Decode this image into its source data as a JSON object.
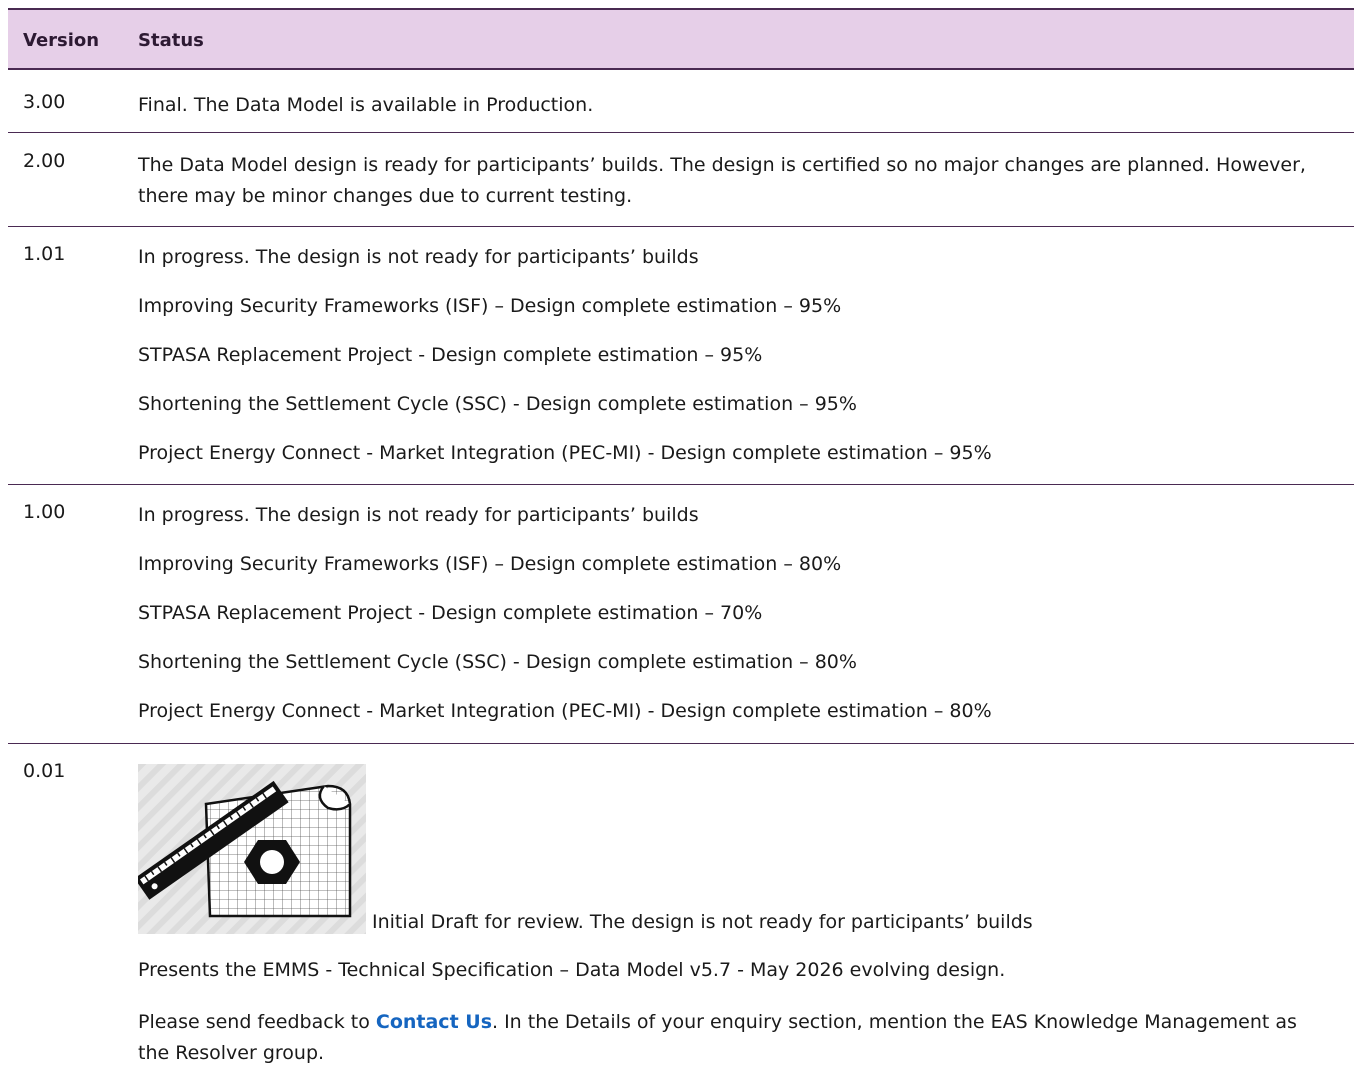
{
  "header": {
    "version": "Version",
    "status": "Status"
  },
  "rows": [
    {
      "version": "3.00",
      "lines": [
        "Final. The Data Model is available in Production."
      ]
    },
    {
      "version": "2.00",
      "lines": [
        "The Data Model design is ready for participants’ builds. The design is certified so no major changes are planned. However, there may be minor changes due to current testing."
      ]
    },
    {
      "version": "1.01",
      "lines": [
        "In progress. The design is not ready for participants’ builds",
        "Improving Security Frameworks (ISF) – Design complete estimation – 95%",
        "STPASA Replacement Project - Design complete estimation – 95%",
        "Shortening the Settlement Cycle (SSC) - Design complete estimation – 95%",
        "Project Energy Connect - Market Integration (PEC-MI) - Design complete estimation – 95%"
      ]
    },
    {
      "version": "1.00",
      "lines": [
        "In progress. The design is not ready for participants’ builds",
        "Improving Security Frameworks (ISF) – Design complete estimation – 80%",
        "STPASA Replacement Project - Design complete estimation – 70%",
        "Shortening the Settlement Cycle (SSC) - Design complete estimation – 80%",
        "Project Energy Connect - Market Integration (PEC-MI) - Design complete estimation – 80%"
      ]
    },
    {
      "version": "0.01",
      "draft": "Initial Draft for review. The design is not ready for participants’ builds",
      "presents": "Presents the EMMS - Technical Specification – Data Model v5.7 - May 2026 evolving design.",
      "feedback_pre": "Please send feedback to ",
      "feedback_link": "Contact Us",
      "feedback_post": ". In the Details of your enquiry section, mention the EAS Knowledge Management as the Resolver group."
    }
  ],
  "colors": {
    "header_bg": "#e6cfe8",
    "rule": "#4a2a52",
    "link": "#1565c0"
  },
  "icons": {
    "draft_figure": "ruler-grid-nut-icon"
  }
}
